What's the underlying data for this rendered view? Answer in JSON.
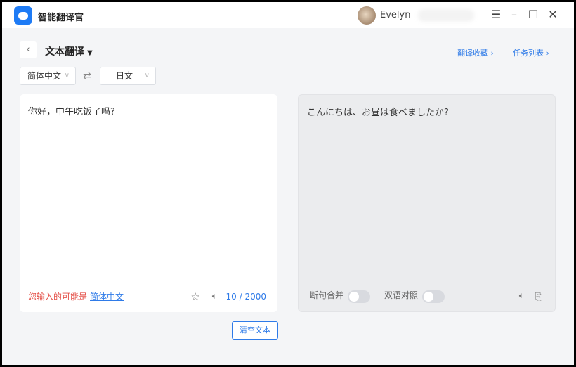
{
  "app": {
    "name": "智能翻译官",
    "user": "Evelyn"
  },
  "toolbar": {
    "mode": "文本翻译",
    "favorites": "翻译收藏 ›",
    "tasks": "任务列表 ›"
  },
  "languages": {
    "source": "简体中文",
    "target": "日文"
  },
  "source": {
    "text": "你好，中午吃饭了吗?",
    "hint_prefix": "您输入的可能是",
    "hint_lang": "简体中文",
    "count": "10 / 2000"
  },
  "target": {
    "text": "こんにちは、お昼は食べましたか?",
    "toggle1": "断句合并",
    "toggle2": "双语对照",
    "toggle1_on": false,
    "toggle2_on": false
  },
  "actions": {
    "clear": "清空文本"
  }
}
